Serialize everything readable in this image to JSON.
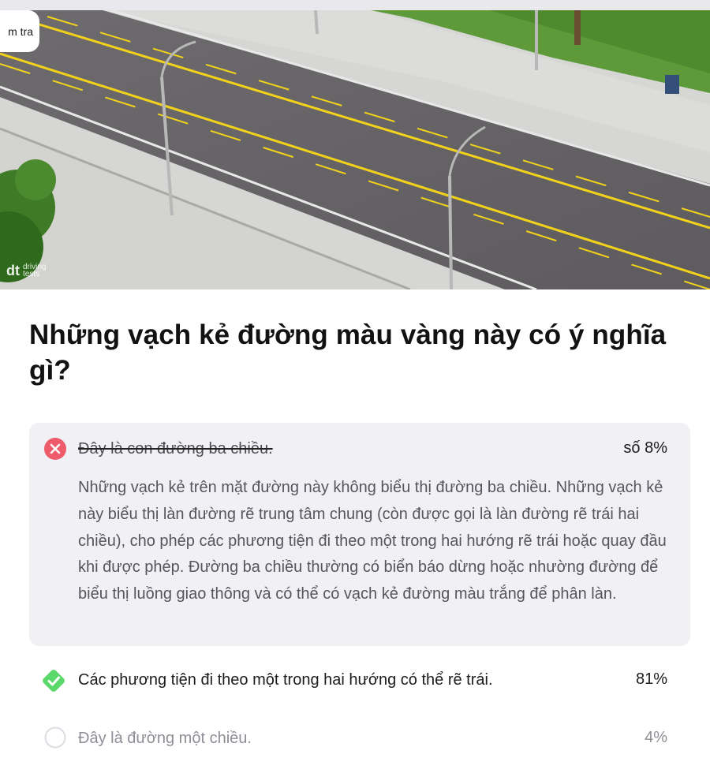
{
  "header": {
    "pill_text": "m tra",
    "watermark": {
      "line1": "driving",
      "line2": "tests"
    }
  },
  "question": {
    "text": "Những vạch kẻ đường màu vàng này có ý nghĩa gì?"
  },
  "answers": [
    {
      "label": "Đây là con đường ba chiều.",
      "percent": "số 8%",
      "state": "wrong",
      "icon": "x-circle-icon",
      "explanation": "Những vạch kẻ trên mặt đường này không biểu thị đường ba chiều. Những vạch kẻ này biểu thị làn đường rẽ trung tâm chung (còn được gọi là làn đường rẽ trái hai chiều), cho phép các phương tiện đi theo một trong hai hướng rẽ trái hoặc quay đầu khi được phép. Đường ba chiều thường có biển báo dừng hoặc nhường đường để biểu thị luồng giao thông và có thể có vạch kẻ đường màu trắng để phân làn."
    },
    {
      "label": "Các phương tiện đi theo một trong hai hướng có thể rẽ trái.",
      "percent": "81%",
      "state": "correct",
      "icon": "check-diamond-icon"
    },
    {
      "label": "Đây là đường một chiều.",
      "percent": "4%",
      "state": "neutral",
      "icon": "empty-circle-icon"
    }
  ],
  "colors": {
    "wrong": "#ee5b6b",
    "correct": "#5bd86a",
    "wrong_panel": "#f1f1f5",
    "road_line": "#f3d21c"
  }
}
